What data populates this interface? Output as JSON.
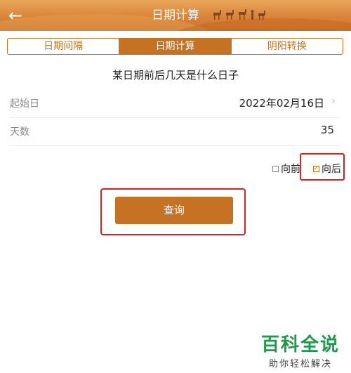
{
  "header": {
    "back_icon": "arrow-left-icon",
    "title": "日期计算"
  },
  "tabs": [
    {
      "label": "日期间隔",
      "active": false
    },
    {
      "label": "日期计算",
      "active": true
    },
    {
      "label": "阴阳转换",
      "active": false
    }
  ],
  "subtitle": "某日期前后几天是什么日子",
  "form": {
    "start_label": "起始日",
    "start_value": "2022年02月16日",
    "days_label": "天数",
    "days_value": "35"
  },
  "direction": {
    "before_label": "向前",
    "before_checked": false,
    "after_label": "向后",
    "after_checked": true
  },
  "query_label": "查询",
  "watermark": {
    "title": "百科全说",
    "subtitle": "助你轻松解决"
  },
  "colors": {
    "accent": "#c57222",
    "highlight": "#e11d1d",
    "watermark": "#1e9a4a"
  }
}
